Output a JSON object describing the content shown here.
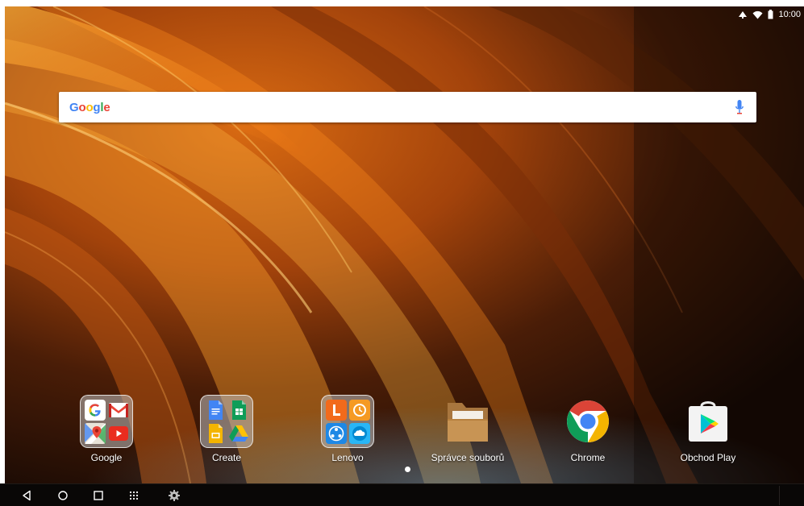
{
  "status_bar": {
    "time": "10:00",
    "icons": [
      "data-saver-icon",
      "wifi-icon",
      "battery-icon"
    ]
  },
  "search_widget": {
    "logo": "Google",
    "logo_colors": [
      "#4285F4",
      "#EA4335",
      "#FBBC05",
      "#4285F4",
      "#34A853",
      "#EA4335"
    ],
    "icon": "microphone-icon",
    "mic_color": "#4285F4"
  },
  "dock": [
    {
      "label": "Google",
      "kind": "folder",
      "icons": [
        "google-icon",
        "gmail-icon",
        "maps-icon",
        "youtube-icon"
      ]
    },
    {
      "label": "Create",
      "kind": "folder",
      "icons": [
        "docs-icon",
        "sheets-icon",
        "slides-icon",
        "drive-icon"
      ]
    },
    {
      "label": "Lenovo",
      "kind": "folder",
      "icons": [
        "lenovo-icon",
        "lenovo-clock-icon",
        "share-it-icon",
        "lenovo-cloud-icon"
      ]
    },
    {
      "label": "Správce souborů",
      "kind": "app",
      "icon": "file-manager-icon"
    },
    {
      "label": "Chrome",
      "kind": "app",
      "icon": "chrome-icon"
    },
    {
      "label": "Obchod Play",
      "kind": "app",
      "icon": "play-store-icon"
    }
  ],
  "page_indicator": {
    "pages": 1,
    "active": 1
  },
  "nav_bar": {
    "buttons": [
      "back-icon",
      "home-icon",
      "recents-icon",
      "app-drawer-icon",
      "settings-icon"
    ]
  }
}
